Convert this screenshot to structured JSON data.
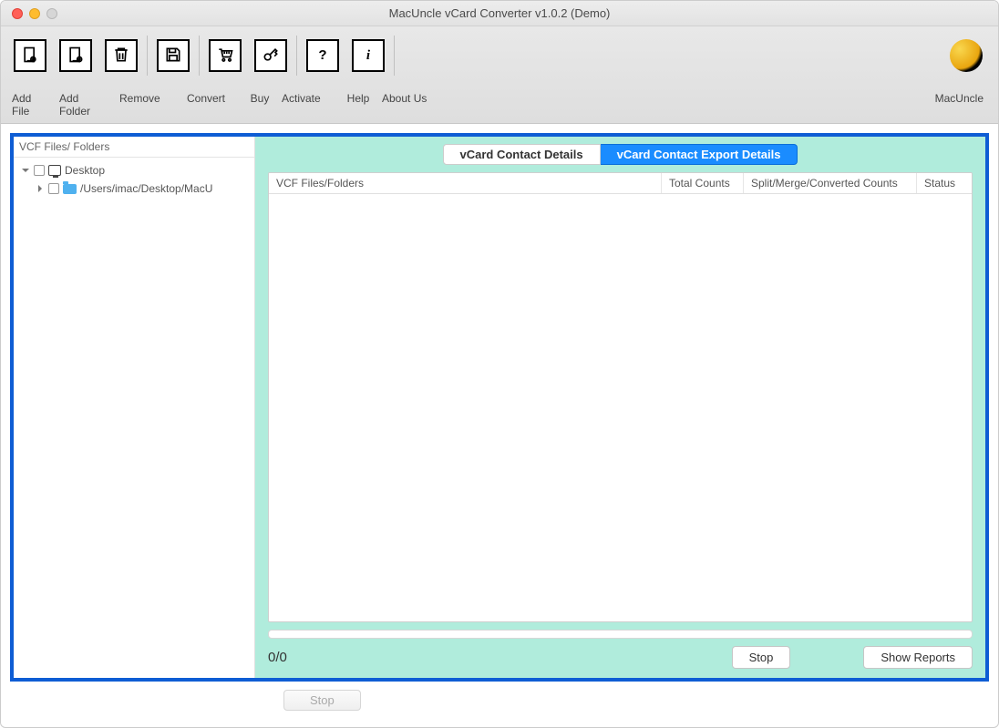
{
  "window": {
    "title": "MacUncle vCard Converter v1.0.2 (Demo)"
  },
  "toolbar": {
    "add_file": "Add File",
    "add_folder": "Add Folder",
    "remove": "Remove",
    "convert": "Convert",
    "buy": "Buy",
    "activate": "Activate",
    "help": "Help",
    "about": "About Us",
    "brand": "MacUncle"
  },
  "left_panel": {
    "header": "VCF Files/ Folders",
    "tree": {
      "root": "Desktop",
      "child": "/Users/imac/Desktop/MacU"
    }
  },
  "tabs": {
    "contact_details": "vCard Contact Details",
    "export_details": "vCard Contact Export Details"
  },
  "table": {
    "col_files": "VCF Files/Folders",
    "col_total": "Total Counts",
    "col_split": "Split/Merge/Converted Counts",
    "col_status": "Status"
  },
  "progress": {
    "counter": "0/0",
    "stop": "Stop",
    "show_reports": "Show Reports"
  },
  "bottom": {
    "stop": "Stop"
  }
}
